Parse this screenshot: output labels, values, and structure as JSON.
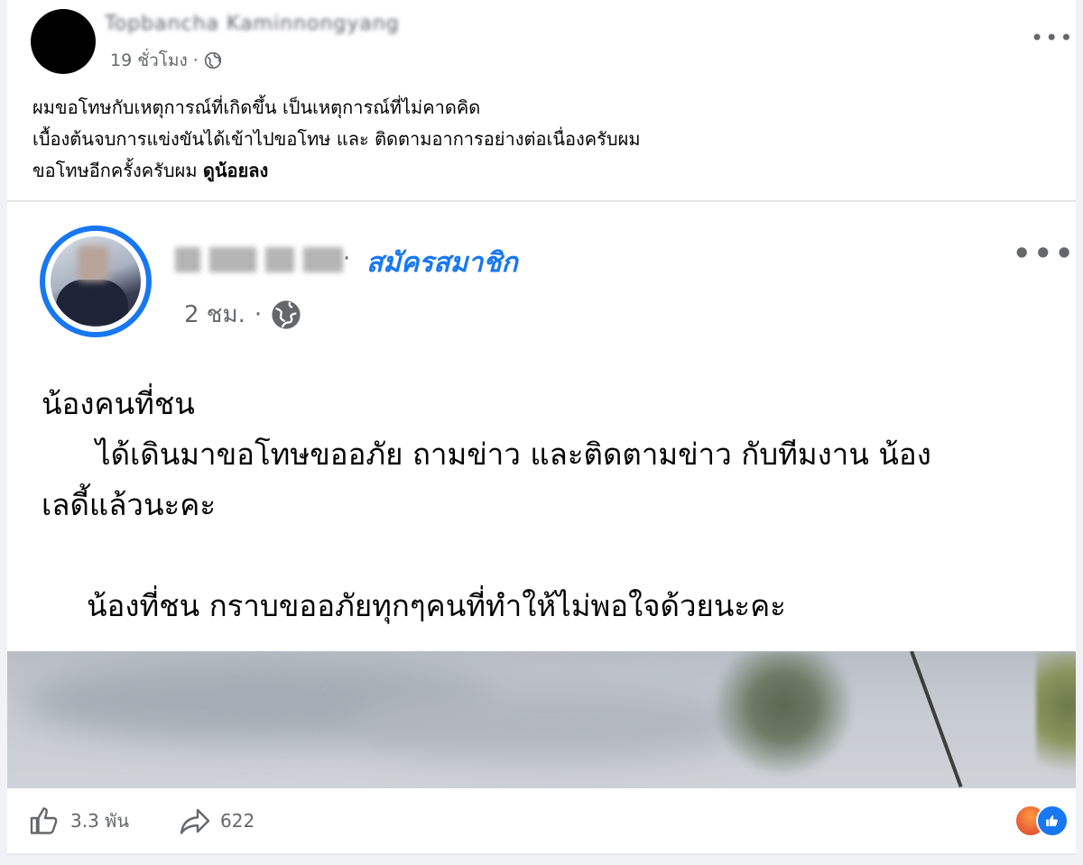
{
  "top_post": {
    "author": "Topbancha Kaminnongyang",
    "time": "19 ชั่วโมง",
    "privacy_icon": "globe-icon",
    "caption_lines": [
      "ผมขอโทษกับเหตุการณ์ที่เกิดขึ้น เป็นเหตุการณ์ที่ไม่คาดคิด",
      "เบื้องต้นจบการแข่งขันได้เข้าไปขอโทษ และ ติดตามอาการอย่างต่อเนื่องครับผม",
      "ขอโทษอีกครั้งครับผม"
    ],
    "see_less": "ดูน้อยลง"
  },
  "shared_post": {
    "join_label": "สมัครสมาชิก",
    "time": "2 ชม.",
    "privacy_icon": "globe-icon",
    "body": {
      "line1": "น้องคนที่ชน",
      "line2": "ได้เดินมาขอโทษขออภัย ถามข่าว และติดตามข่าว กับทีมงาน น้อง",
      "line3": "เลดี้แล้วนะคะ",
      "line4": "น้องที่ชน กราบขออภัยทุกๆคนที่ทำให้ไม่พอใจด้วยนะคะ"
    }
  },
  "actions": {
    "like_count": "3.3 พัน",
    "share_count": "622"
  },
  "colors": {
    "accent": "#1877f2",
    "meta_text": "#65676b",
    "background": "#f0f2f5"
  }
}
